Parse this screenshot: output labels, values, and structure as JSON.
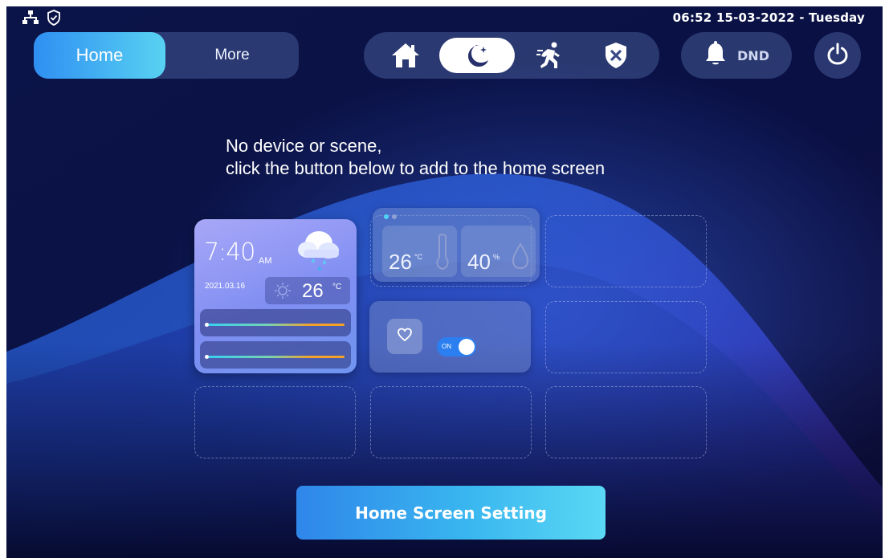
{
  "status_bar": {
    "datetime": "06:52  15-03-2022 - Tuesday",
    "icons": [
      "network-icon",
      "shield-check-icon"
    ]
  },
  "tabs": {
    "home_label": "Home",
    "more_label": "More",
    "selected": "Home"
  },
  "arming_modes": {
    "items": [
      "home-mode-icon",
      "night-mode-icon",
      "away-mode-icon",
      "disarm-icon"
    ],
    "selected": "night-mode-icon"
  },
  "dnd": {
    "label": "DND",
    "icon": "bell-icon"
  },
  "power": {
    "icon": "power-icon"
  },
  "message": {
    "line1": "No device or scene,",
    "line2": "click the button below to add to the home screen"
  },
  "preview": {
    "weather": {
      "time": "7:40",
      "ampm": "AM",
      "date": "2021.03.16",
      "temperature": "26",
      "temperature_unit": "°C",
      "icon": "cloud-rain-icon"
    },
    "climate": {
      "temperature": "26",
      "temperature_unit": "°C",
      "humidity": "40",
      "humidity_unit": "%"
    },
    "switch": {
      "state": "ON",
      "icon": "heart-icon"
    }
  },
  "home_screen_setting": {
    "label": "Home Screen Setting"
  },
  "colors": {
    "background": "#0a0f3e",
    "accent_start": "#2f8ff2",
    "accent_end": "#58d2f2",
    "panel": "#5f78b9",
    "toggle_on": "#2c7ff0"
  }
}
